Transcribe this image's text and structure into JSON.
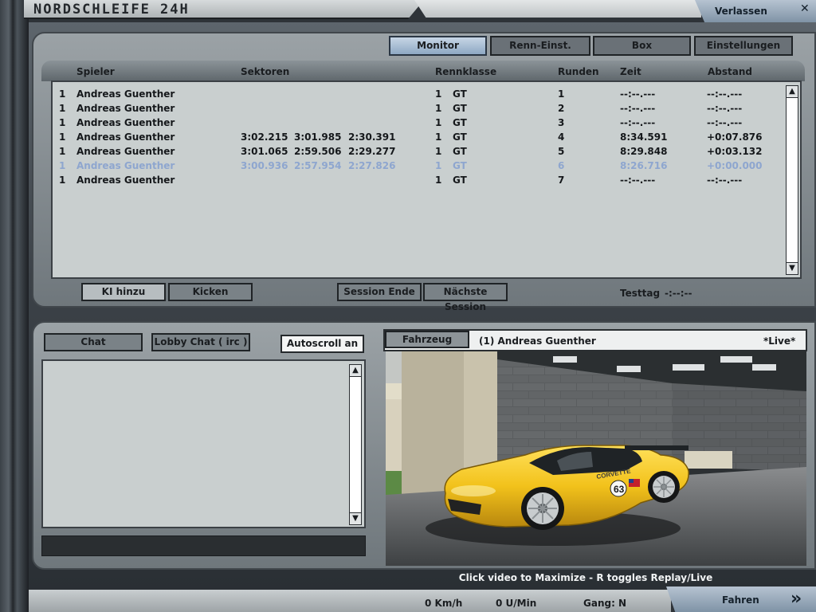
{
  "window": {
    "title": "NORDSCHLEIFE 24H",
    "exit_label": "Verlassen",
    "exit_icon": "close-icon"
  },
  "tabs": [
    {
      "label": "Monitor",
      "active": true
    },
    {
      "label": "Renn-Einst.",
      "active": false
    },
    {
      "label": "Box",
      "active": false
    },
    {
      "label": "Einstellungen",
      "active": false
    }
  ],
  "table": {
    "headers": {
      "player": "Spieler",
      "sectors": "Sektoren",
      "class": "Rennklasse",
      "laps": "Runden",
      "time": "Zeit",
      "gap": "Abstand"
    },
    "rows": [
      {
        "pos": "1",
        "name": "Andreas Guenther",
        "s1": "",
        "s2": "",
        "s3": "",
        "cls_num": "1",
        "cls": "GT",
        "lap": "1",
        "time": "--:--.---",
        "gap": "--:--.---",
        "selected": false
      },
      {
        "pos": "1",
        "name": "Andreas Guenther",
        "s1": "",
        "s2": "",
        "s3": "",
        "cls_num": "1",
        "cls": "GT",
        "lap": "2",
        "time": "--:--.---",
        "gap": "--:--.---",
        "selected": false
      },
      {
        "pos": "1",
        "name": "Andreas Guenther",
        "s1": "",
        "s2": "",
        "s3": "",
        "cls_num": "1",
        "cls": "GT",
        "lap": "3",
        "time": "--:--.---",
        "gap": "--:--.---",
        "selected": false
      },
      {
        "pos": "1",
        "name": "Andreas Guenther",
        "s1": "3:02.215",
        "s2": "3:01.985",
        "s3": "2:30.391",
        "cls_num": "1",
        "cls": "GT",
        "lap": "4",
        "time": "8:34.591",
        "gap": "+0:07.876",
        "selected": false
      },
      {
        "pos": "1",
        "name": "Andreas Guenther",
        "s1": "3:01.065",
        "s2": "2:59.506",
        "s3": "2:29.277",
        "cls_num": "1",
        "cls": "GT",
        "lap": "5",
        "time": "8:29.848",
        "gap": "+0:03.132",
        "selected": false
      },
      {
        "pos": "1",
        "name": "Andreas Guenther",
        "s1": "3:00.936",
        "s2": "2:57.954",
        "s3": "2:27.826",
        "cls_num": "1",
        "cls": "GT",
        "lap": "6",
        "time": "8:26.716",
        "gap": "+0:00.000",
        "selected": true
      },
      {
        "pos": "1",
        "name": "Andreas Guenther",
        "s1": "",
        "s2": "",
        "s3": "",
        "cls_num": "1",
        "cls": "GT",
        "lap": "7",
        "time": "--:--.---",
        "gap": "--:--.---",
        "selected": false
      }
    ]
  },
  "session_buttons": {
    "add_ai": "KI hinzu",
    "kick": "Kicken",
    "end_session": "Session Ende",
    "next_session": "Nächste Session"
  },
  "session_status": {
    "label": "Testtag",
    "value": "-:--:--"
  },
  "chat": {
    "chat_label": "Chat",
    "lobby_label": "Lobby Chat ( irc )",
    "autoscroll_label": "Autoscroll an",
    "input_value": ""
  },
  "vehicle": {
    "button_label": "Fahrzeug",
    "driver": "(1) Andreas Guenther",
    "mode": "*Live*",
    "car_number": "63",
    "car_sponsor": "CORVETTE"
  },
  "hint": "Click video to Maximize  -  R toggles Replay/Live",
  "telemetry": {
    "speed": "0 Km/h",
    "rpm": "0 U/Min",
    "gear": "Gang: N"
  },
  "drive": {
    "label": "Fahren",
    "icon": "double-chevron-right-icon"
  },
  "colors": {
    "accent": "#8ea8c3",
    "selected_row": "#8ea6cf",
    "panel": "#c9cfcf",
    "car_yellow": "#f2c21b"
  }
}
